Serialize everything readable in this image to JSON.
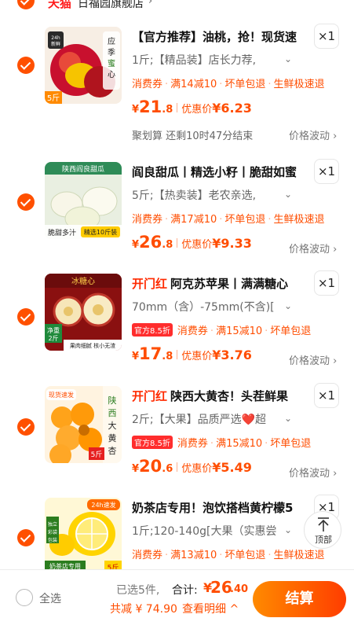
{
  "colors": {
    "accent": "#ff5000",
    "price": "#ff4d00",
    "brand_red": "#ff2a00",
    "official_badge": "#ff2d2d"
  },
  "store": {
    "platform": "天猫",
    "name": "日福园旗舰店",
    "chevron": "›"
  },
  "items": [
    {
      "brand": "",
      "title": "【官方推荐】油桃，抢！现货速",
      "quantity": "×1",
      "sku": "1斤;【精品装】店长力荐,",
      "sku_chevron": "⌄",
      "official_badge": "",
      "promos": [
        "消费券",
        "满14减10",
        "坏单包退",
        "生鲜极速退"
      ],
      "price_currency": "¥",
      "price_int": "21",
      "price_dec": ".8",
      "deal_label": "优惠价",
      "deal_price": "¥6.23",
      "activity": "聚划算 还剩10时47分结束",
      "price_trend": "价格波动 ›",
      "image_labels": {
        "badge": "24h新鲜",
        "side": "应季蜜心油桃",
        "weight": "5斤"
      }
    },
    {
      "brand": "",
      "title": "阎良甜瓜丨精选小籽丨脆甜如蜜",
      "quantity": "×1",
      "sku": "5斤;【热卖装】老农亲选,",
      "sku_chevron": "⌄",
      "official_badge": "",
      "promos": [
        "消费券",
        "满17减10",
        "坏单包退",
        "生鲜极速退"
      ],
      "price_currency": "¥",
      "price_int": "26",
      "price_dec": ".8",
      "deal_label": "优惠价",
      "deal_price": "¥9.33",
      "activity": "",
      "price_trend": "价格波动 ›",
      "image_labels": {
        "top": "陕西阎良甜瓜",
        "bottom_left": "脆甜多汁",
        "bottom_right": "精选10斤装"
      }
    },
    {
      "brand": "开门红",
      "title": "阿克苏苹果丨满满糖心",
      "quantity": "×1",
      "sku": "70mm（含）-75mm(不含)[",
      "sku_chevron": "⌄",
      "official_badge": "官方8.5折",
      "promos": [
        "消费券",
        "满15减10",
        "坏单包退"
      ],
      "price_currency": "¥",
      "price_int": "17",
      "price_dec": ".8",
      "deal_label": "优惠价",
      "deal_price": "¥3.76",
      "activity": "",
      "price_trend": "价格波动 ›",
      "image_labels": {
        "top": "冰糖心",
        "badge": "净重2斤",
        "bottom": "果肉细腻 核小无渣"
      }
    },
    {
      "brand": "开门红",
      "title": "陕西大黄杏！头茬鲜果",
      "quantity": "×1",
      "sku": "2斤;【大果】品质严选❤️超",
      "sku_chevron": "⌄",
      "official_badge": "官方8.5折",
      "promos": [
        "消费券",
        "满15减10",
        "坏单包退"
      ],
      "price_currency": "¥",
      "price_int": "20",
      "price_dec": ".6",
      "deal_label": "优惠价",
      "deal_price": "¥5.49",
      "activity": "",
      "price_trend": "价格波动 ›",
      "image_labels": {
        "badge": "现货速发",
        "side": "陕西大黄杏",
        "weight": "5斤"
      }
    },
    {
      "brand": "",
      "title": "奶茶店专用！泡饮搭档黄柠檬5",
      "quantity": "×1",
      "sku": "1斤;120-140g[大果（实惠尝",
      "sku_chevron": "⌄",
      "official_badge": "",
      "promos": [
        "消费券",
        "满13减10",
        "坏单包退",
        "生鲜极速退"
      ],
      "price_currency": "¥",
      "price_int": "",
      "price_dec": "",
      "deal_label": "",
      "deal_price": "",
      "activity": "",
      "price_trend": "",
      "image_labels": {
        "badge": "24h速发",
        "side": "独立彩袋包装",
        "bottom": "奶茶店专用",
        "weight": "5斤"
      }
    }
  ],
  "back_to_top": {
    "label": "顶部"
  },
  "bottom_bar": {
    "select_all": "全选",
    "selected": "已选5件,",
    "total_label": "合计:",
    "total_currency": "¥",
    "total_int": "26",
    "total_dec": ".40",
    "saved": "共减 ¥ 74.90",
    "detail": "查看明细 ^",
    "checkout": "结算"
  }
}
